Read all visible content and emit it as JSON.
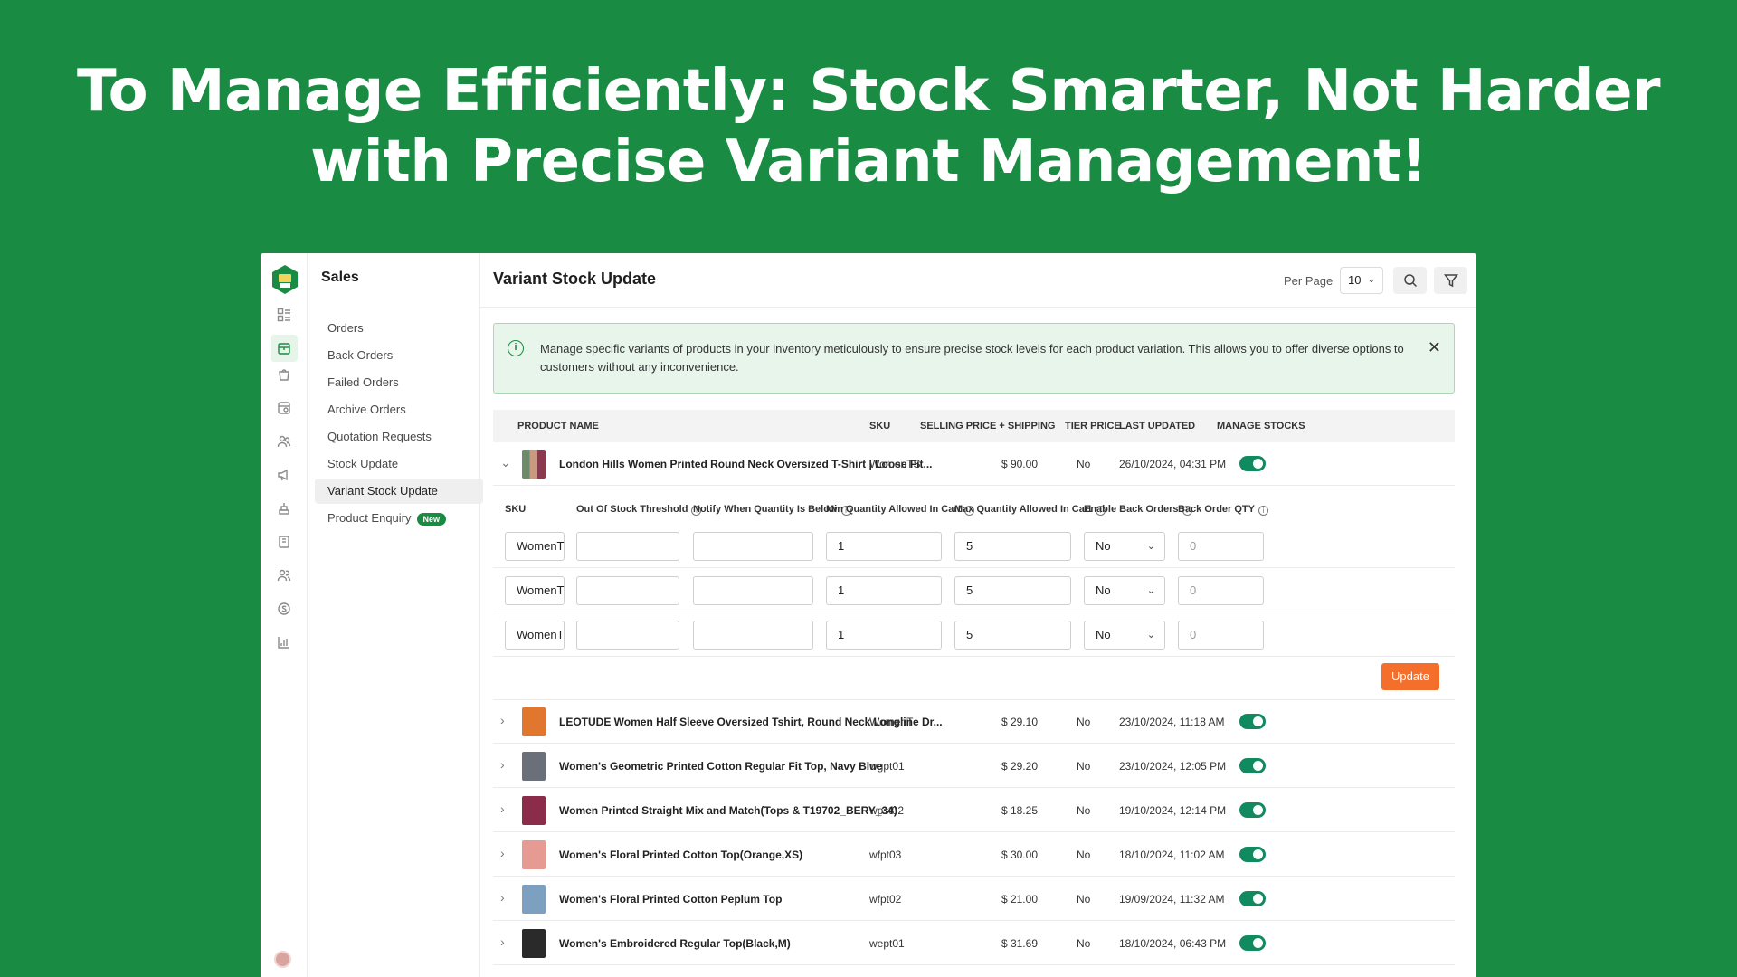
{
  "headline": {
    "line1": "To Manage Efficiently: Stock Smarter, Not Harder",
    "line2": "with Precise Variant Management!"
  },
  "sidebar": {
    "section_title": "Sales",
    "items": [
      {
        "label": "Orders"
      },
      {
        "label": "Back Orders"
      },
      {
        "label": "Failed Orders"
      },
      {
        "label": "Archive Orders"
      },
      {
        "label": "Quotation Requests"
      },
      {
        "label": "Stock Update"
      },
      {
        "label": "Variant Stock Update",
        "active": true
      },
      {
        "label": "Product Enquiry",
        "badge": "New"
      }
    ],
    "rail_icons": [
      "dashboard-icon",
      "sales-icon",
      "bag-icon",
      "catalog-icon",
      "customers-icon",
      "megaphone-icon",
      "stack-icon",
      "book-icon",
      "users-icon",
      "money-icon",
      "report-icon"
    ],
    "accent_color": "#1a8b42"
  },
  "header": {
    "title": "Variant Stock Update",
    "per_page_label": "Per Page",
    "per_page_value": "10"
  },
  "alert": {
    "message": "Manage specific variants of products in your inventory meticulously to ensure precise stock levels for each product variation. This allows you to offer diverse options to customers without any inconvenience."
  },
  "table": {
    "columns": [
      "PRODUCT NAME",
      "SKU",
      "SELLING PRICE + SHIPPING",
      "TIER PRICE",
      "LAST UPDATED",
      "MANAGE STOCKS"
    ],
    "rows": [
      {
        "name": "London Hills Women Printed Round Neck Oversized T-Shirt | Loose Fit...",
        "sku": "WomenTS",
        "price": "$ 90.00",
        "tier": "No",
        "updated": "26/10/2024, 04:31 PM",
        "manage": true,
        "expanded": true,
        "thumb_color": "#b08a6e"
      },
      {
        "name": "LEOTUDE Women Half Sleeve Oversized Tshirt, Round Neck Longline Dr...",
        "sku": "WomenT",
        "price": "$ 29.10",
        "tier": "No",
        "updated": "23/10/2024, 11:18 AM",
        "manage": true,
        "thumb_color": "#e1762f"
      },
      {
        "name": "Women's Geometric Printed Cotton Regular Fit Top, Navy Blue",
        "sku": "wgpt01",
        "price": "$ 29.20",
        "tier": "No",
        "updated": "23/10/2024, 12:05 PM",
        "manage": true,
        "thumb_color": "#6a6f7a"
      },
      {
        "name": "Women Printed Straight Mix and Match(Tops & T19702_BERY_34)",
        "sku": "wpst02",
        "price": "$ 18.25",
        "tier": "No",
        "updated": "19/10/2024, 12:14 PM",
        "manage": true,
        "thumb_color": "#8a2c4a"
      },
      {
        "name": "Women's Floral Printed Cotton Top(Orange,XS)",
        "sku": "wfpt03",
        "price": "$ 30.00",
        "tier": "No",
        "updated": "18/10/2024, 11:02 AM",
        "manage": true,
        "thumb_color": "#e59a92"
      },
      {
        "name": "Women's Floral Printed Cotton Peplum Top",
        "sku": "wfpt02",
        "price": "$ 21.00",
        "tier": "No",
        "updated": "19/09/2024, 11:32 AM",
        "manage": true,
        "thumb_color": "#7d9fc0"
      },
      {
        "name": "Women's Embroidered Regular Top(Black,M)",
        "sku": "wept01",
        "price": "$ 31.69",
        "tier": "No",
        "updated": "18/10/2024, 06:43 PM",
        "manage": true,
        "thumb_color": "#2a2a2a"
      }
    ]
  },
  "variants": {
    "columns": [
      "SKU",
      "Out Of Stock Threshold",
      "Notify When Quantity Is Below",
      "Min Quantity Allowed In Cart",
      "Max Quantity Allowed In Cart",
      "Enable Back Orders",
      "Back Order QTY"
    ],
    "rows": [
      {
        "sku": "WomenT",
        "oos": "",
        "notify": "",
        "min": "1",
        "max": "5",
        "back": "No",
        "qty_placeholder": "0"
      },
      {
        "sku": "WomenT",
        "oos": "",
        "notify": "",
        "min": "1",
        "max": "5",
        "back": "No",
        "qty_placeholder": "0"
      },
      {
        "sku": "WomenT",
        "oos": "",
        "notify": "",
        "min": "1",
        "max": "5",
        "back": "No",
        "qty_placeholder": "0"
      }
    ],
    "update_label": "Update",
    "update_color": "#f36f2b"
  },
  "toggle_color": "#128a60"
}
